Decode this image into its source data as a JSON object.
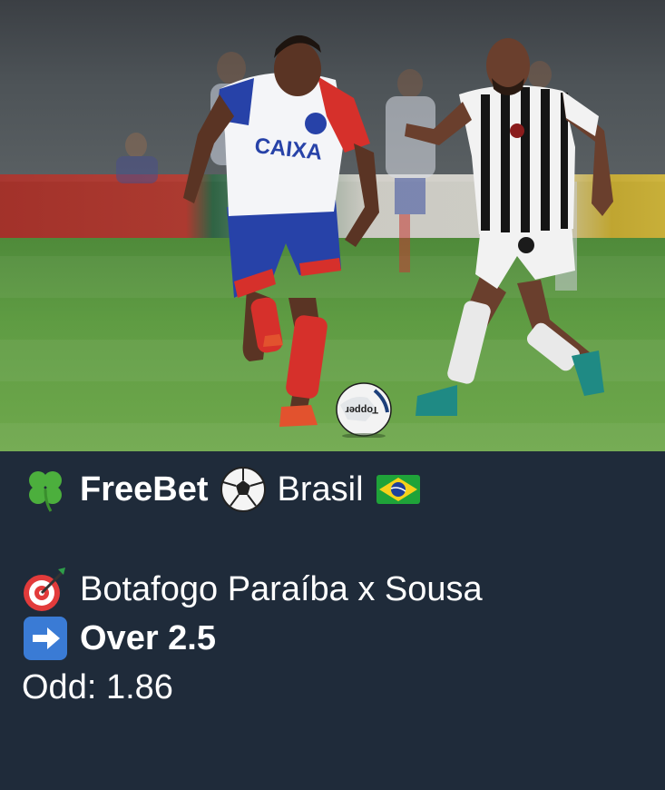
{
  "photo": {
    "ball_brand": "Topper",
    "sponsor": "CAIXA"
  },
  "message": {
    "line1": {
      "icon1": "four-leaf-clover-icon",
      "label_bold": "FreeBet",
      "icon2": "soccer-ball-icon",
      "country": "Brasil",
      "icon3": "brazil-flag-icon"
    },
    "match": {
      "icon": "direct-hit-target-icon",
      "text": "Botafogo Paraíba x Sousa"
    },
    "tip": {
      "icon": "right-arrow-icon",
      "text": "Over 2.5"
    },
    "odd": {
      "text": "Odd: 1.86"
    }
  },
  "colors": {
    "background": "#1f2b3a",
    "text": "#ffffff",
    "arrow_box": "#3a7bd5"
  }
}
